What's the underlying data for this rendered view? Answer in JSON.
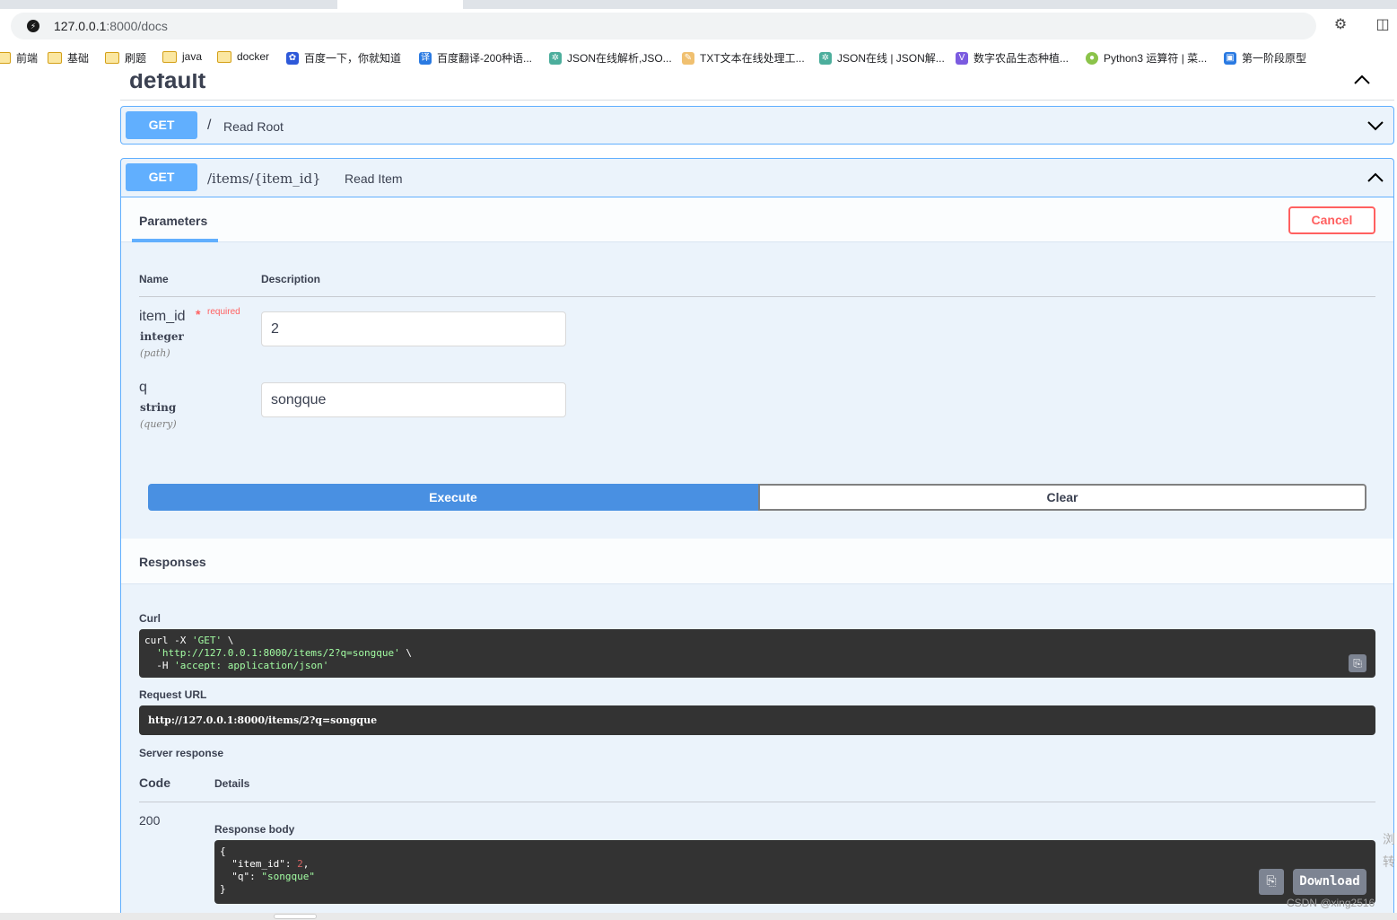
{
  "browser": {
    "url_host": "127.0.0.1",
    "url_rest": ":8000/docs",
    "bookmarks": [
      {
        "label": "前端",
        "type": "folder"
      },
      {
        "label": "基础",
        "type": "folder"
      },
      {
        "label": "刷题",
        "type": "folder"
      },
      {
        "label": "java",
        "type": "folder"
      },
      {
        "label": "docker",
        "type": "folder"
      },
      {
        "label": "百度一下，你就知道",
        "type": "site"
      },
      {
        "label": "百度翻译-200种语...",
        "type": "site"
      },
      {
        "label": "JSON在线解析,JSO...",
        "type": "site"
      },
      {
        "label": "TXT文本在线处理工...",
        "type": "site"
      },
      {
        "label": "JSON在线 | JSON解...",
        "type": "site"
      },
      {
        "label": "数字农品生态种植...",
        "type": "site"
      },
      {
        "label": "Python3 运算符 | 菜...",
        "type": "site"
      },
      {
        "label": "第一阶段原型",
        "type": "site"
      }
    ]
  },
  "section": {
    "title": "default"
  },
  "op_root": {
    "method": "GET",
    "path": "/",
    "summary": "Read Root"
  },
  "op_item": {
    "method": "GET",
    "path": "/items/{item_id}",
    "summary": "Read Item",
    "tab_parameters": "Parameters",
    "cancel_label": "Cancel",
    "col_name": "Name",
    "col_description": "Description",
    "params": [
      {
        "name": "item_id",
        "required_mark": "*",
        "required_label": "required",
        "type": "integer",
        "in": "(path)",
        "value": "2"
      },
      {
        "name": "q",
        "type": "string",
        "in": "(query)",
        "value": "songque"
      }
    ],
    "execute_label": "Execute",
    "clear_label": "Clear"
  },
  "responses": {
    "title": "Responses",
    "curl_label": "Curl",
    "curl": {
      "l1_a": "curl -X ",
      "l1_b": "'GET'",
      "l1_c": " \\",
      "l2_a": "  ",
      "l2_b": "'http://127.0.0.1:8000/items/2?q=songque'",
      "l2_c": " \\",
      "l3_a": "  -H ",
      "l3_b": "'accept: application/json'"
    },
    "request_url_label": "Request URL",
    "request_url": "http://127.0.0.1:8000/items/2?q=songque",
    "server_response_label": "Server response",
    "code_label": "Code",
    "details_label": "Details",
    "status_code": "200",
    "response_body_label": "Response body",
    "body": {
      "open": "{",
      "k1": "  \"item_id\"",
      "v1": "2",
      "k2": "  \"q\"",
      "v2": "\"songque\"",
      "close": "}"
    },
    "download_label": "Download"
  },
  "watermark": "CSDN @xing2516",
  "side_chars": [
    "浏",
    "转"
  ]
}
